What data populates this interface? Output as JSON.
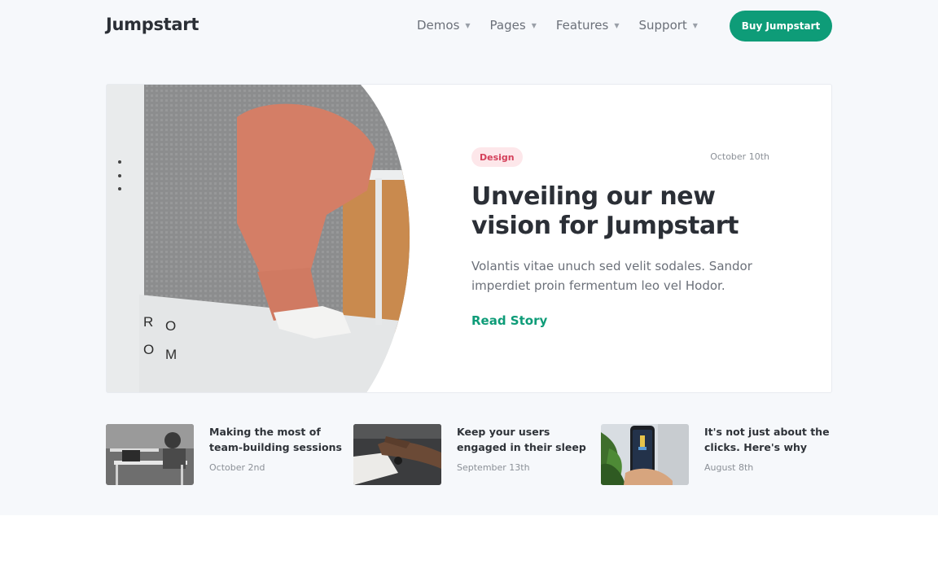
{
  "header": {
    "brand": "Jumpstart",
    "nav": [
      {
        "label": "Demos"
      },
      {
        "label": "Pages"
      },
      {
        "label": "Features"
      },
      {
        "label": "Support"
      }
    ],
    "cta_label": "Buy Jumpstart"
  },
  "hero": {
    "tag": "Design",
    "date": "October 10th",
    "title": "Unveiling our new vision for Jumpstart",
    "description": "Volantis vitae unuch sed velit sodales. Sandor imperdiet proin fermentum leo vel Hodor.",
    "link_label": "Read Story",
    "image_letters": [
      "R",
      "O",
      "O",
      "M"
    ]
  },
  "posts": [
    {
      "title": "Making the most of team-building sessions",
      "date": "October 2nd"
    },
    {
      "title": "Keep your users engaged in their sleep",
      "date": "September 13th"
    },
    {
      "title": "It's not just about the clicks. Here's why",
      "date": "August 8th"
    }
  ],
  "colors": {
    "accent": "#0e9c78",
    "tag_bg": "#fde7ea",
    "tag_text": "#d4405a",
    "band_bg": "#f6f8fb"
  }
}
